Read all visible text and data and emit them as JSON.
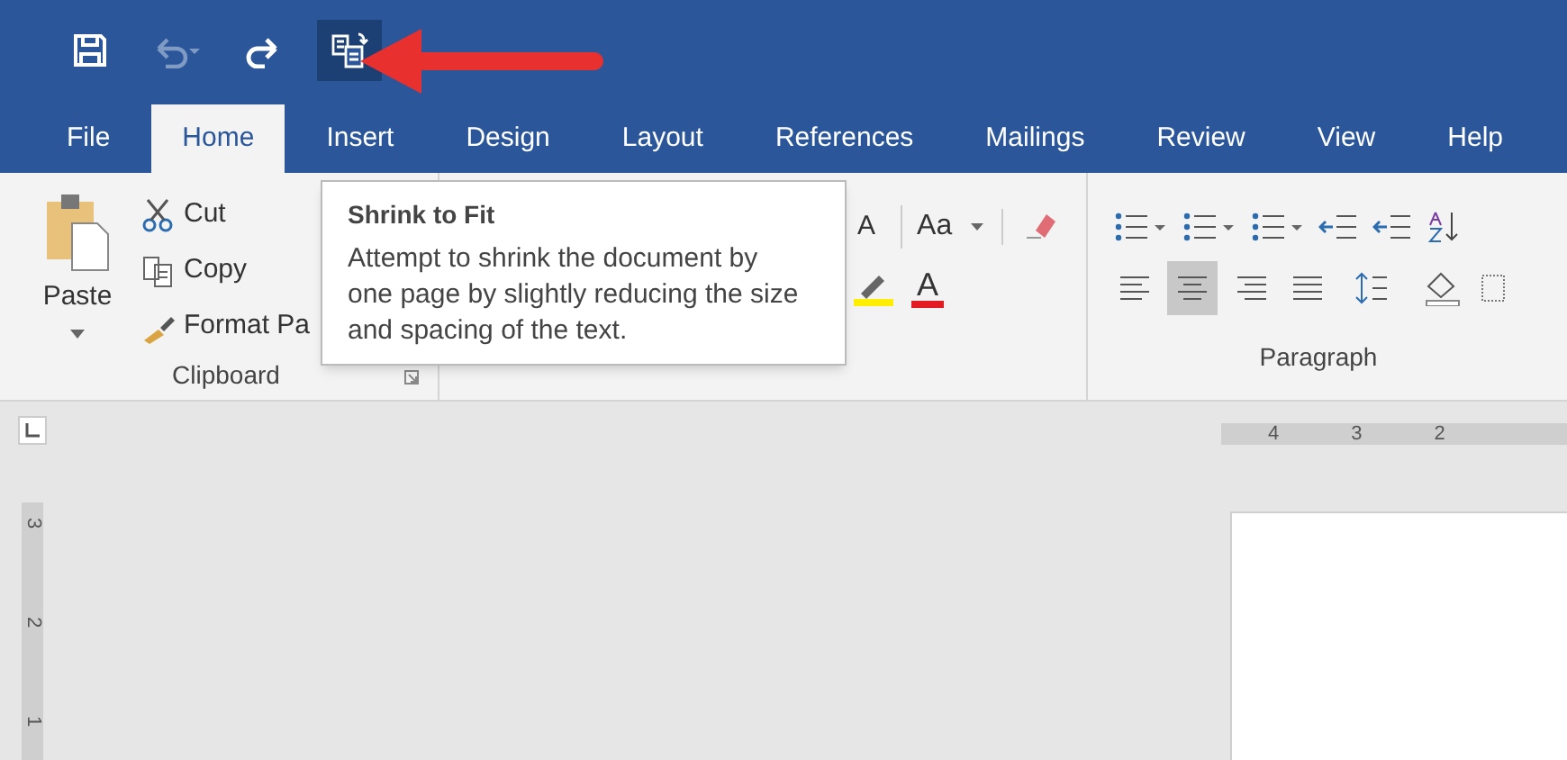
{
  "quick_access": [
    {
      "kind": "save",
      "disabled": false,
      "highlighted": false
    },
    {
      "kind": "undo",
      "disabled": true,
      "highlighted": false
    },
    {
      "kind": "redo",
      "disabled": false,
      "highlighted": false
    },
    {
      "kind": "shrink",
      "disabled": false,
      "highlighted": true
    }
  ],
  "tabs": [
    {
      "label": "File",
      "selected": false
    },
    {
      "label": "Home",
      "selected": true
    },
    {
      "label": "Insert",
      "selected": false
    },
    {
      "label": "Design",
      "selected": false
    },
    {
      "label": "Layout",
      "selected": false
    },
    {
      "label": "References",
      "selected": false
    },
    {
      "label": "Mailings",
      "selected": false
    },
    {
      "label": "Review",
      "selected": false
    },
    {
      "label": "View",
      "selected": false
    },
    {
      "label": "Help",
      "selected": false
    }
  ],
  "clipboard": {
    "paste": "Paste",
    "commands": [
      {
        "kind": "cut",
        "label": "Cut"
      },
      {
        "kind": "copy",
        "label": "Copy"
      },
      {
        "kind": "painter",
        "label": "Format Pa"
      }
    ],
    "group_label": "Clipboard"
  },
  "font": {
    "grow": "A",
    "change_case": "Aa",
    "font_color": "A"
  },
  "paragraph": {
    "alignment": [
      {
        "kind": "left",
        "selected": false
      },
      {
        "kind": "center",
        "selected": true
      },
      {
        "kind": "right",
        "selected": false
      },
      {
        "kind": "justify",
        "selected": false
      }
    ],
    "group_label": "Paragraph"
  },
  "tooltip": {
    "title": "Shrink to Fit",
    "body": "Attempt to shrink the document by one page by slightly reducing the size and spacing of the text."
  },
  "horizontal_ruler": [
    "4",
    "3",
    "2"
  ],
  "vertical_ruler": [
    "3",
    "2",
    "1"
  ]
}
